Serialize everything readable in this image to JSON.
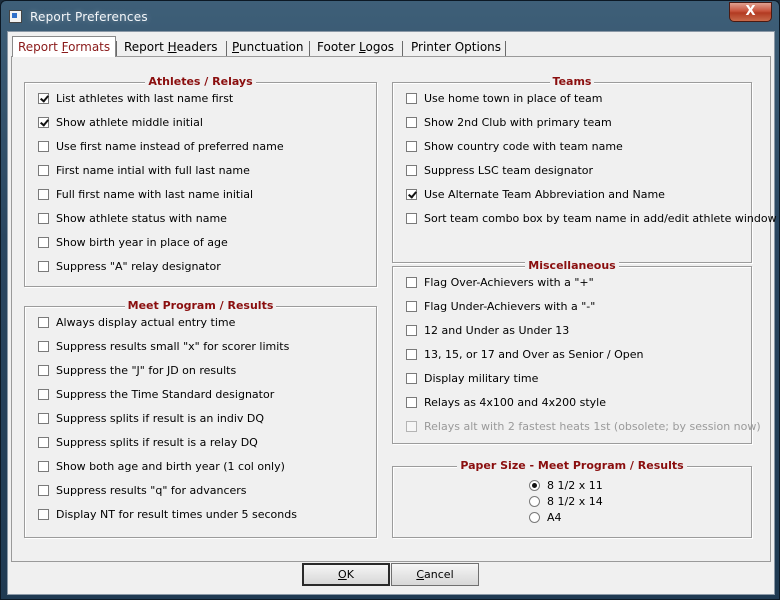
{
  "window": {
    "title": "Report Preferences",
    "close_label": "X"
  },
  "tabs": [
    {
      "label": "Report Formats",
      "mnemonic": "F"
    },
    {
      "label": "Report Headers",
      "mnemonic": "H"
    },
    {
      "label": "Punctuation",
      "mnemonic": "P"
    },
    {
      "label": "Footer Logos",
      "mnemonic": "L"
    },
    {
      "label": "Printer Options",
      "mnemonic": ""
    }
  ],
  "groups": {
    "athletes": {
      "title": "Athletes / Relays",
      "items": [
        {
          "label": "List athletes with last name first",
          "checked": true
        },
        {
          "label": "Show athlete middle initial",
          "checked": true
        },
        {
          "label": "Use first name instead of preferred name",
          "checked": false
        },
        {
          "label": "First name intial with full last name",
          "checked": false
        },
        {
          "label": "Full first name with last name initial",
          "checked": false
        },
        {
          "label": "Show athlete status with name",
          "checked": false
        },
        {
          "label": "Show birth year in place of age",
          "checked": false
        },
        {
          "label": "Suppress \"A\" relay designator",
          "checked": false
        }
      ]
    },
    "meet": {
      "title": "Meet Program / Results",
      "items": [
        {
          "label": "Always display actual entry time",
          "checked": false
        },
        {
          "label": "Suppress results small \"x\" for scorer limits",
          "checked": false
        },
        {
          "label": "Suppress the \"J\" for JD on results",
          "checked": false
        },
        {
          "label": "Suppress the Time Standard designator",
          "checked": false
        },
        {
          "label": "Suppress splits if result is an indiv DQ",
          "checked": false
        },
        {
          "label": "Suppress splits if result is a relay DQ",
          "checked": false
        },
        {
          "label": "Show both age and birth year (1 col only)",
          "checked": false
        },
        {
          "label": "Suppress results \"q\" for advancers",
          "checked": false
        },
        {
          "label": "Display NT for result times under 5 seconds",
          "checked": false
        }
      ]
    },
    "teams": {
      "title": "Teams",
      "items": [
        {
          "label": "Use home town in place of team",
          "checked": false
        },
        {
          "label": "Show 2nd Club with primary team",
          "checked": false
        },
        {
          "label": "Show country code with team name",
          "checked": false
        },
        {
          "label": "Suppress LSC team designator",
          "checked": false
        },
        {
          "label": "Use Alternate Team Abbreviation and Name",
          "checked": true
        },
        {
          "label": "Sort team combo box by team name in add/edit athlete window",
          "checked": false
        }
      ]
    },
    "misc": {
      "title": "Miscellaneous",
      "items": [
        {
          "label": "Flag Over-Achievers with a \"+\"",
          "checked": false
        },
        {
          "label": "Flag Under-Achievers with a \"-\"",
          "checked": false
        },
        {
          "label": "12 and Under as Under 13",
          "checked": false
        },
        {
          "label": "13, 15, or 17 and Over as Senior / Open",
          "checked": false
        },
        {
          "label": "Display military time",
          "checked": false
        },
        {
          "label": "Relays as 4x100 and 4x200 style",
          "checked": false
        },
        {
          "label": "Relays alt with 2 fastest heats 1st (obsolete; by session now)",
          "checked": false,
          "disabled": true
        }
      ]
    },
    "paper": {
      "title": "Paper Size - Meet Program / Results",
      "options": [
        {
          "label": "8 1/2 x 11",
          "selected": true
        },
        {
          "label": "8 1/2 x 14",
          "selected": false
        },
        {
          "label": "A4",
          "selected": false
        }
      ]
    }
  },
  "buttons": {
    "ok": {
      "label": "OK",
      "mnemonic": "O"
    },
    "cancel": {
      "label": "Cancel",
      "mnemonic": "C"
    }
  },
  "colors": {
    "group_title": "#8a0e0e",
    "active_tab_text": "#8a1a1a",
    "disabled_text": "#9a9a9a"
  }
}
